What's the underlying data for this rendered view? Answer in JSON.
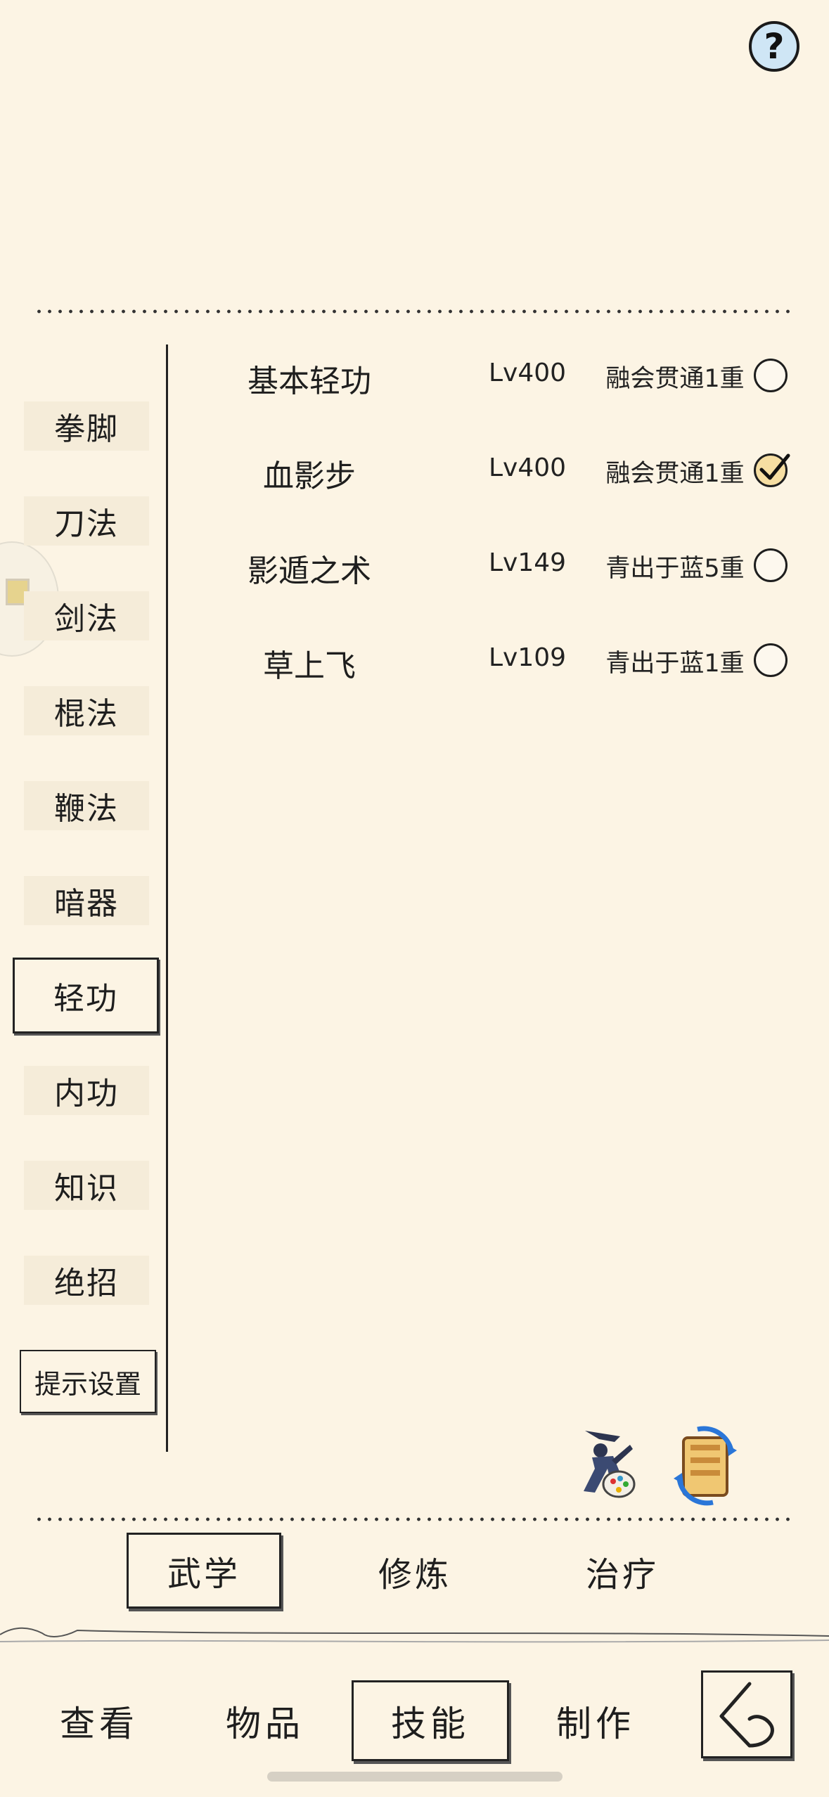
{
  "help_button": {
    "label": "?"
  },
  "categories": [
    {
      "label": "拳脚"
    },
    {
      "label": "刀法"
    },
    {
      "label": "剑法"
    },
    {
      "label": "棍法"
    },
    {
      "label": "鞭法"
    },
    {
      "label": "暗器"
    },
    {
      "label": "轻功",
      "active": true
    },
    {
      "label": "内功"
    },
    {
      "label": "知识"
    },
    {
      "label": "绝招"
    }
  ],
  "hint_settings_label": "提示设置",
  "skills": [
    {
      "name": "基本轻功",
      "level": "Lv400",
      "rank": "融会贯通1重",
      "selected": false
    },
    {
      "name": "血影步",
      "level": "Lv400",
      "rank": "融会贯通1重",
      "selected": true
    },
    {
      "name": "影遁之术",
      "level": "Lv149",
      "rank": "青出于蓝5重",
      "selected": false
    },
    {
      "name": "草上飞",
      "level": "Lv109",
      "rank": "青出于蓝1重",
      "selected": false
    }
  ],
  "sub_tabs": [
    {
      "label": "武学",
      "active": true
    },
    {
      "label": "修炼"
    },
    {
      "label": "治疗"
    }
  ],
  "bottom_nav": [
    {
      "label": "查看"
    },
    {
      "label": "物品"
    },
    {
      "label": "技能",
      "active": true
    },
    {
      "label": "制作"
    }
  ],
  "icons": {
    "help": "question-circle-icon",
    "tool_1": "martial-artist-palette-icon",
    "tool_2": "scroll-swap-icon",
    "back": "back-arrow-icon",
    "check": "checkmark-icon"
  },
  "colors": {
    "background": "#fcf4e4",
    "help_button": "#cfe6f5",
    "checked_radio": "#f6dea2",
    "ink": "#1e1e1e"
  }
}
